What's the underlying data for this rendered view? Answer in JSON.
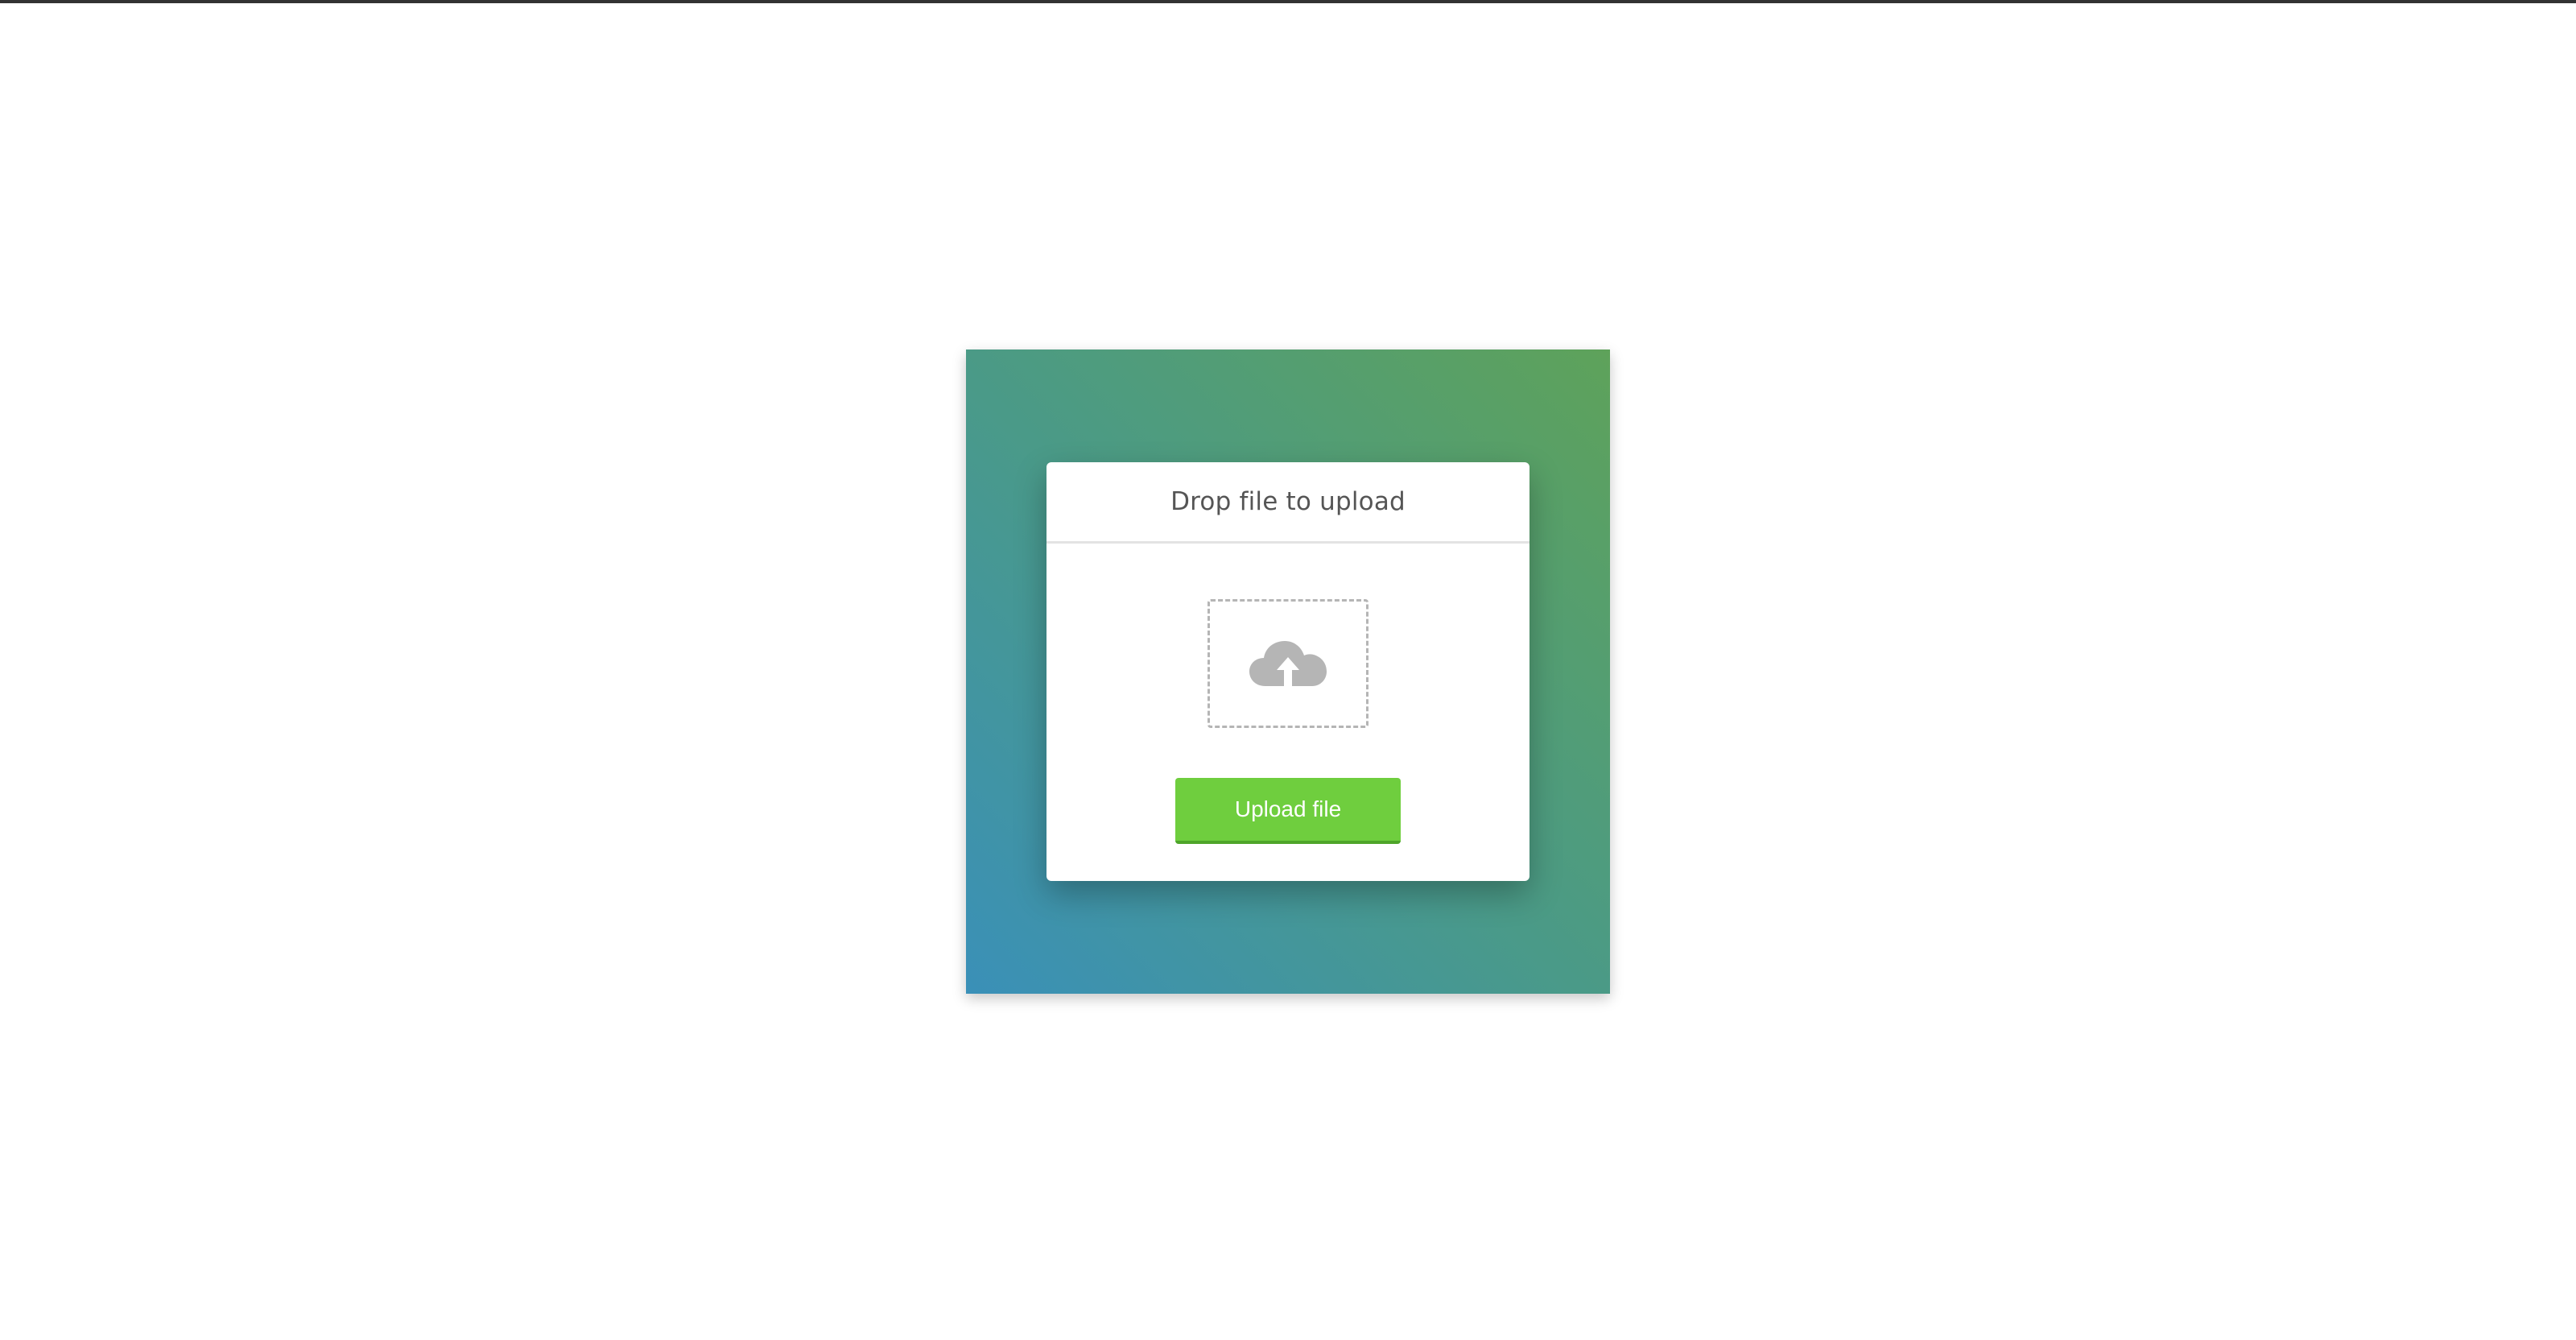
{
  "upload_dialog": {
    "title": "Drop file to upload",
    "button_label": "Upload file",
    "drop_icon": "cloud-upload-icon"
  },
  "colors": {
    "gradient_start": "#3a90b8",
    "gradient_end": "#5ea25a",
    "button": "#6fce3e",
    "title_text": "#555555",
    "icon": "#b5b5b5"
  }
}
